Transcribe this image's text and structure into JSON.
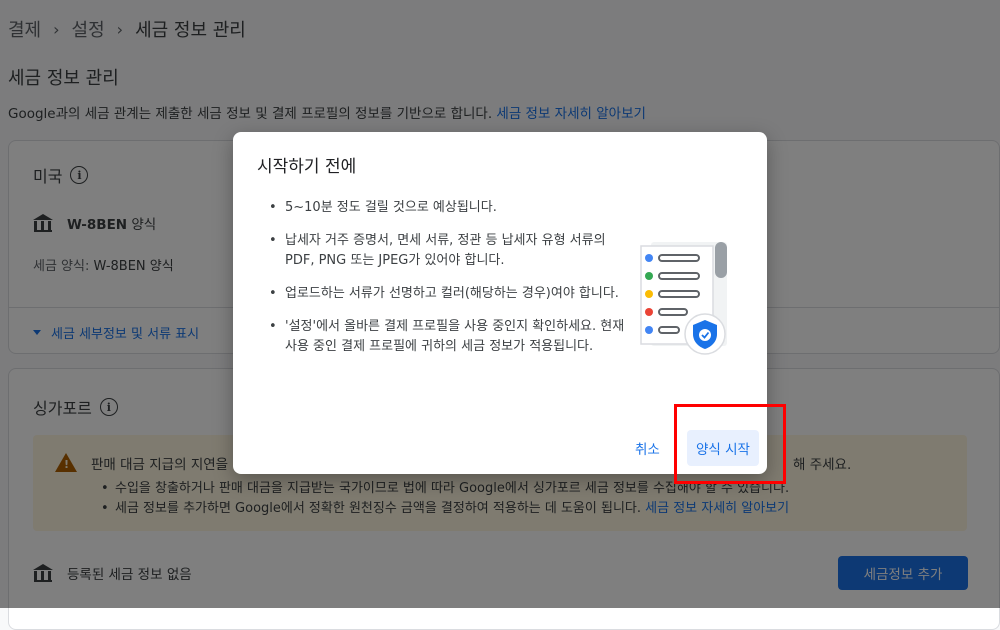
{
  "breadcrumb": {
    "items": [
      "결제",
      "설정",
      "세금 정보 관리"
    ]
  },
  "page": {
    "title": "세금 정보 관리",
    "description": "Google과의 세금 관계는 제출한 세금 정보 및 결제 프로필의 정보를 기반으로 합니다.",
    "learn_more": "세금 정보 자세히 알아보기"
  },
  "us_card": {
    "title": "미국",
    "form_name": "W-8BEN",
    "form_suffix": "양식",
    "tax_form_label": "세금 양식:",
    "tax_form_value": "W-8BEN 양식",
    "details_toggle": "세금 세부정보 및 서류 표시"
  },
  "sg_card": {
    "title": "싱가포르",
    "warning_text": "판매 대금 지급의 지연을",
    "warning_text_right": "해 주세요.",
    "bullets": [
      "수입을 창출하거나 판매 대금을 지급받는 국가이므로 법에 따라 Google에서 싱가포르 세금 정보를 수집해야 할 수 있습니다.",
      "세금 정보를 추가하면 Google에서 정확한 원천징수 금액을 결정하여 적용하는 데 도움이 됩니다."
    ],
    "learn_more": "세금 정보 자세히 알아보기",
    "no_tax_info": "등록된 세금 정보 없음",
    "add_button": "세금정보 추가"
  },
  "dialog": {
    "title": "시작하기 전에",
    "items": [
      "5~10분 정도 걸릴 것으로 예상됩니다.",
      "납세자 거주 증명서, 면세 서류, 정관 등 납세자 유형 서류의 PDF, PNG 또는 JPEG가 있어야 합니다.",
      "업로드하는 서류가 선명하고 컬러(해당하는 경우)여야 합니다.",
      "'설정'에서 올바른 결제 프로필을 사용 중인지 확인하세요. 현재 사용 중인 결제 프로필에 귀하의 세금 정보가 적용됩니다."
    ],
    "cancel_button": "취소",
    "start_button": "양식 시작"
  },
  "colors": {
    "accent": "#1a73e8",
    "warning_bg": "#fef7e0",
    "warning_icon": "#b06000",
    "highlight": "#ff0000"
  },
  "icons": [
    "info-icon",
    "bank-icon",
    "warning-icon",
    "chevron-right-icon",
    "caret-down-icon",
    "document-shield-icon"
  ]
}
